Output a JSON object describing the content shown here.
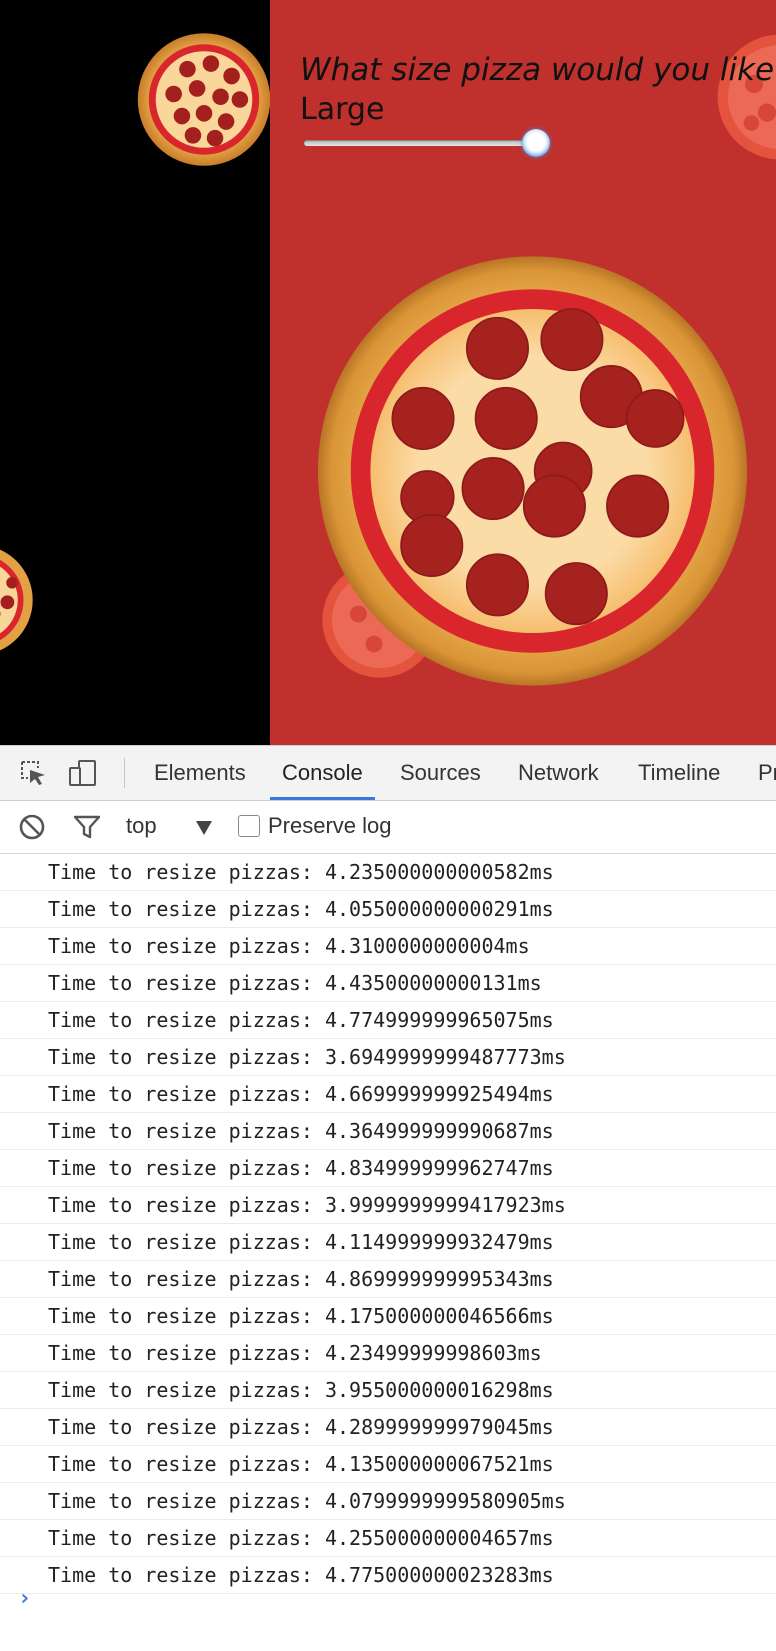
{
  "page": {
    "question": "What size pizza would you like? U",
    "size_value": "Large",
    "slider_fraction": 1.0
  },
  "devtools": {
    "tabs": [
      {
        "label": "Elements"
      },
      {
        "label": "Console",
        "active": true
      },
      {
        "label": "Sources"
      },
      {
        "label": "Network"
      },
      {
        "label": "Timeline"
      },
      {
        "label": "Pr"
      }
    ],
    "context": "top",
    "preserve_log_label": "Preserve log",
    "preserve_log_checked": false,
    "prompt_glyph": "›",
    "log": [
      "Time to resize pizzas: 4.235000000000582ms",
      "Time to resize pizzas: 4.055000000000291ms",
      "Time to resize pizzas: 4.3100000000004ms",
      "Time to resize pizzas: 4.43500000000131ms",
      "Time to resize pizzas: 4.774999999965075ms",
      "Time to resize pizzas: 3.6949999999487773ms",
      "Time to resize pizzas: 4.669999999925494ms",
      "Time to resize pizzas: 4.364999999990687ms",
      "Time to resize pizzas: 4.834999999962747ms",
      "Time to resize pizzas: 3.9999999999417923ms",
      "Time to resize pizzas: 4.114999999932479ms",
      "Time to resize pizzas: 4.869999999995343ms",
      "Time to resize pizzas: 4.175000000046566ms",
      "Time to resize pizzas: 4.23499999998603ms",
      "Time to resize pizzas: 3.955000000016298ms",
      "Time to resize pizzas: 4.289999999979045ms",
      "Time to resize pizzas: 4.135000000067521ms",
      "Time to resize pizzas: 4.0799999999580905ms",
      "Time to resize pizzas: 4.255000000004657ms",
      "Time to resize pizzas: 4.775000000023283ms"
    ]
  },
  "colors": {
    "page_bg": "#c0302c",
    "left_panel_bg": "#000000",
    "accent": "#3879d9"
  },
  "icons": [
    "inspect-element-icon",
    "device-mode-icon",
    "clear-console-icon",
    "filter-icon",
    "pizza-image"
  ]
}
